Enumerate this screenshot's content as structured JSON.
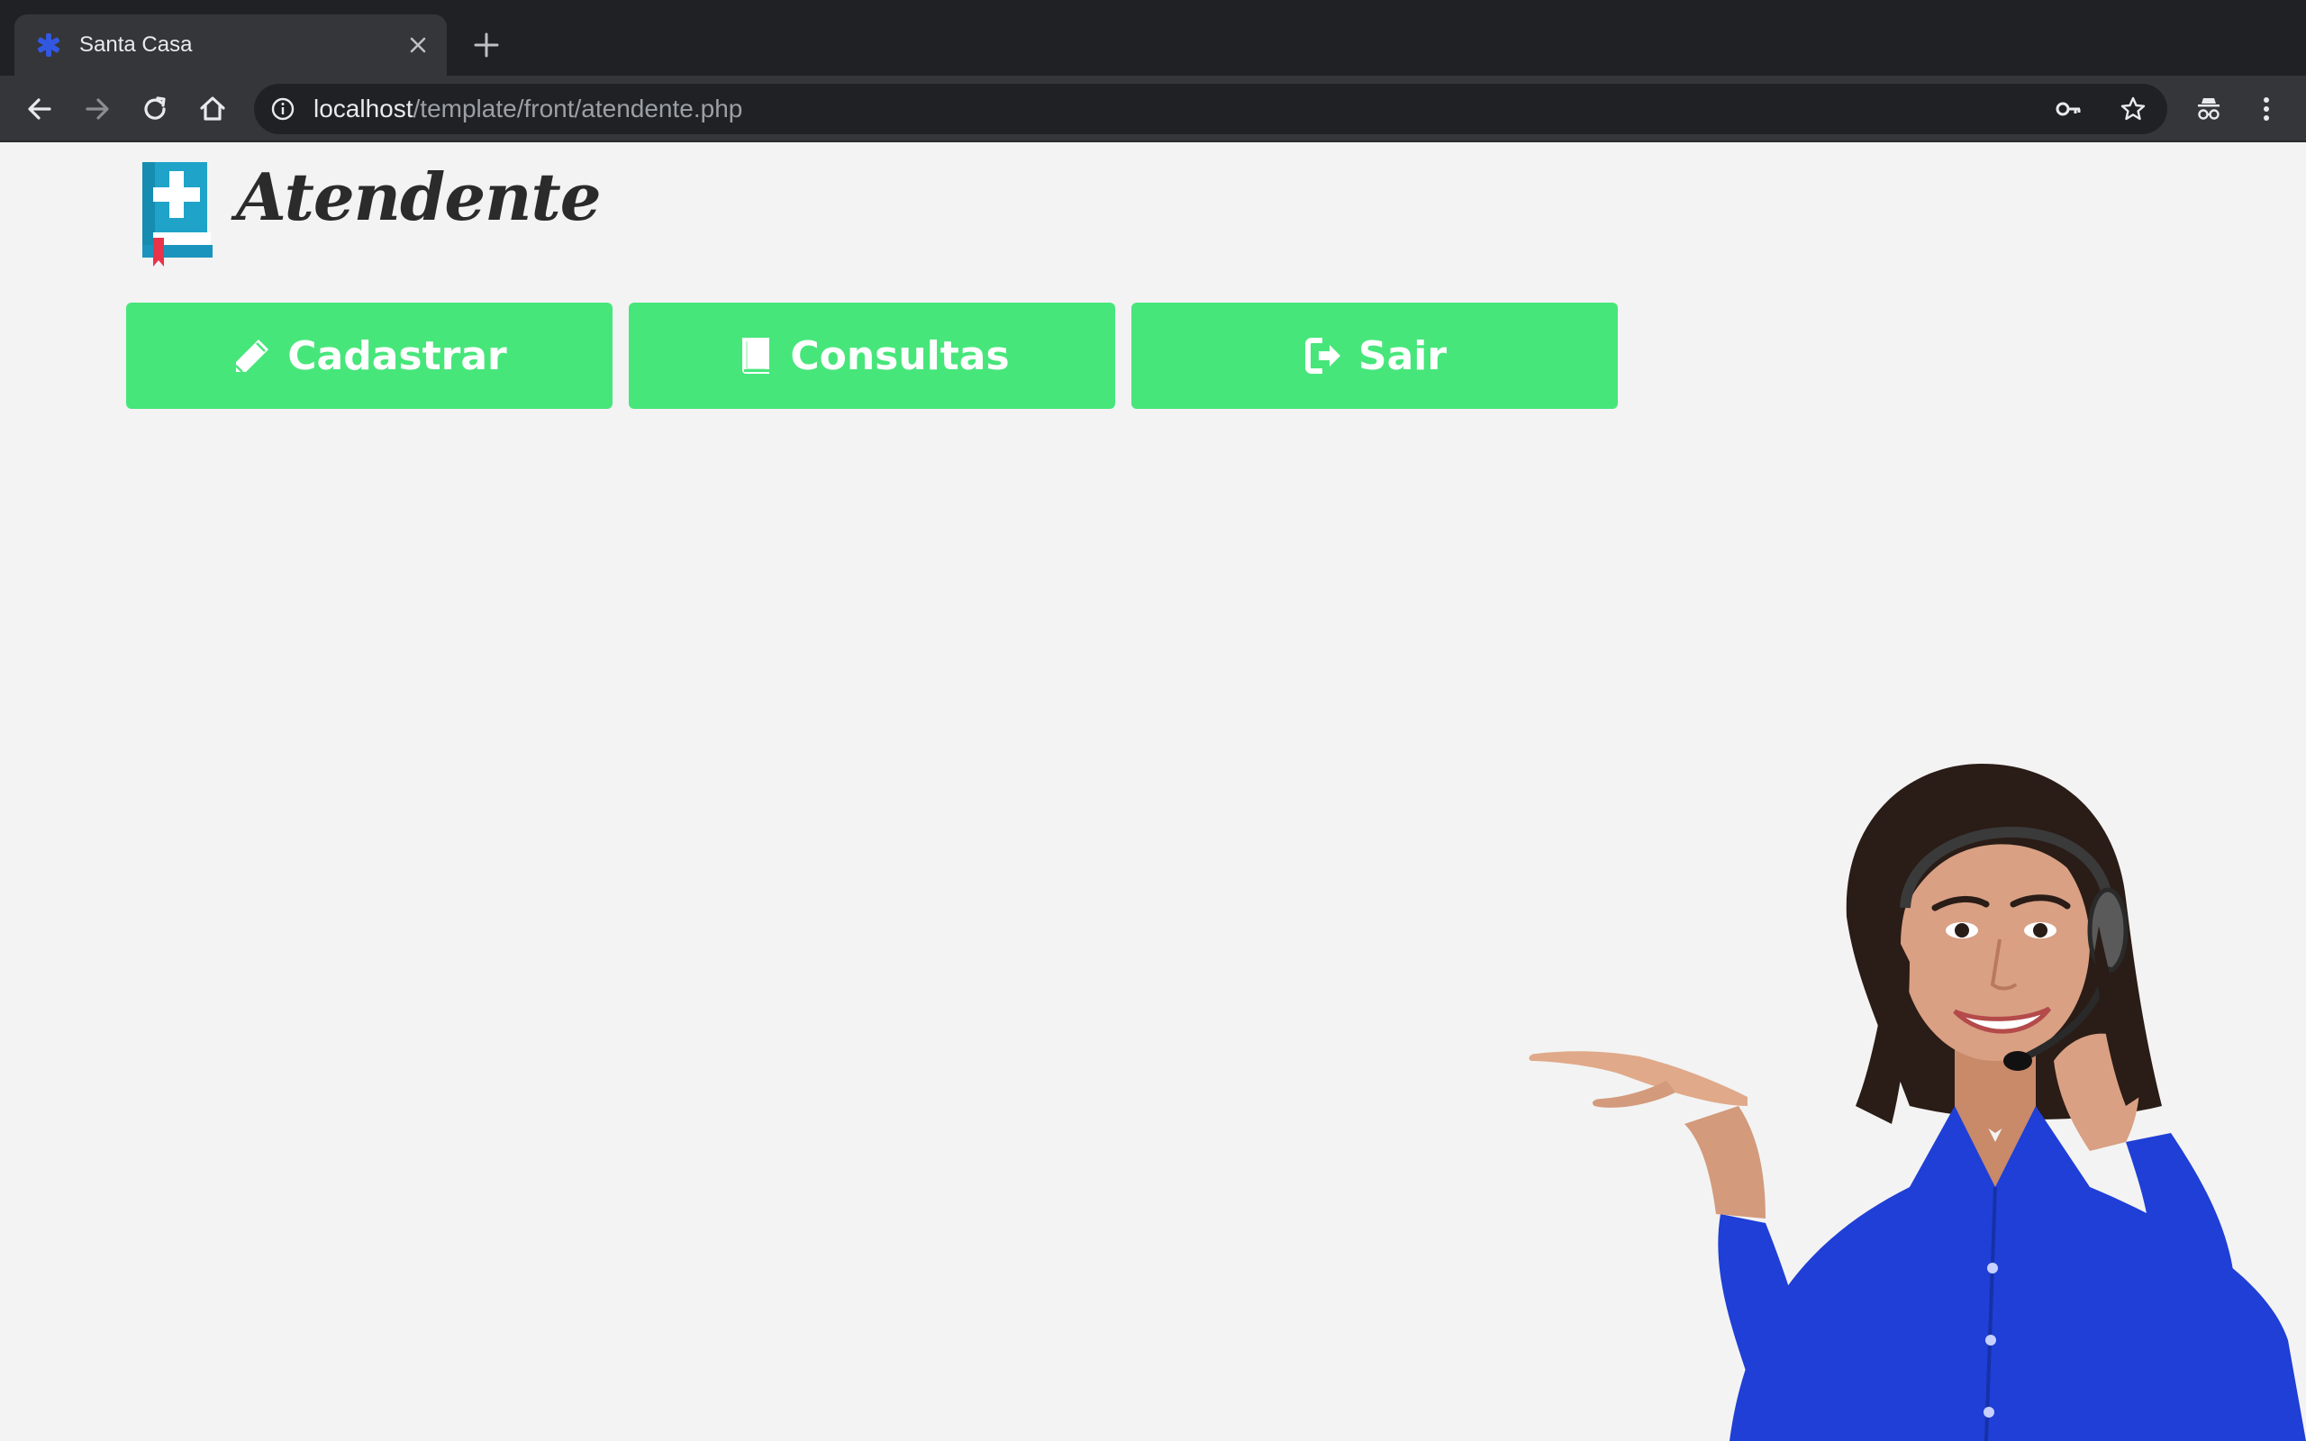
{
  "browser": {
    "tab": {
      "title": "Santa Casa",
      "favicon": "asterisk-medical-icon",
      "close_icon": "close-icon"
    },
    "new_tab_icon": "plus-icon",
    "toolbar": {
      "back_icon": "back-arrow-icon",
      "forward_icon": "forward-arrow-icon",
      "reload_icon": "reload-icon",
      "home_icon": "home-icon",
      "site_info_icon": "info-icon",
      "url_host": "localhost",
      "url_path": "/template/front/atendente.php",
      "key_icon": "key-icon",
      "bookmark_icon": "star-icon",
      "incognito_icon": "incognito-icon",
      "menu_icon": "kebab-menu-icon"
    }
  },
  "header": {
    "logo_icon": "medical-book-logo-icon",
    "title": "Atendente"
  },
  "nav": {
    "buttons": [
      {
        "label": "Cadastrar",
        "icon": "pencil-icon"
      },
      {
        "label": "Consultas",
        "icon": "book-icon"
      },
      {
        "label": "Sair",
        "icon": "sign-out-icon"
      }
    ],
    "color": "#47e67b"
  },
  "illustration": {
    "subject": "call-center-agent-with-headset"
  }
}
